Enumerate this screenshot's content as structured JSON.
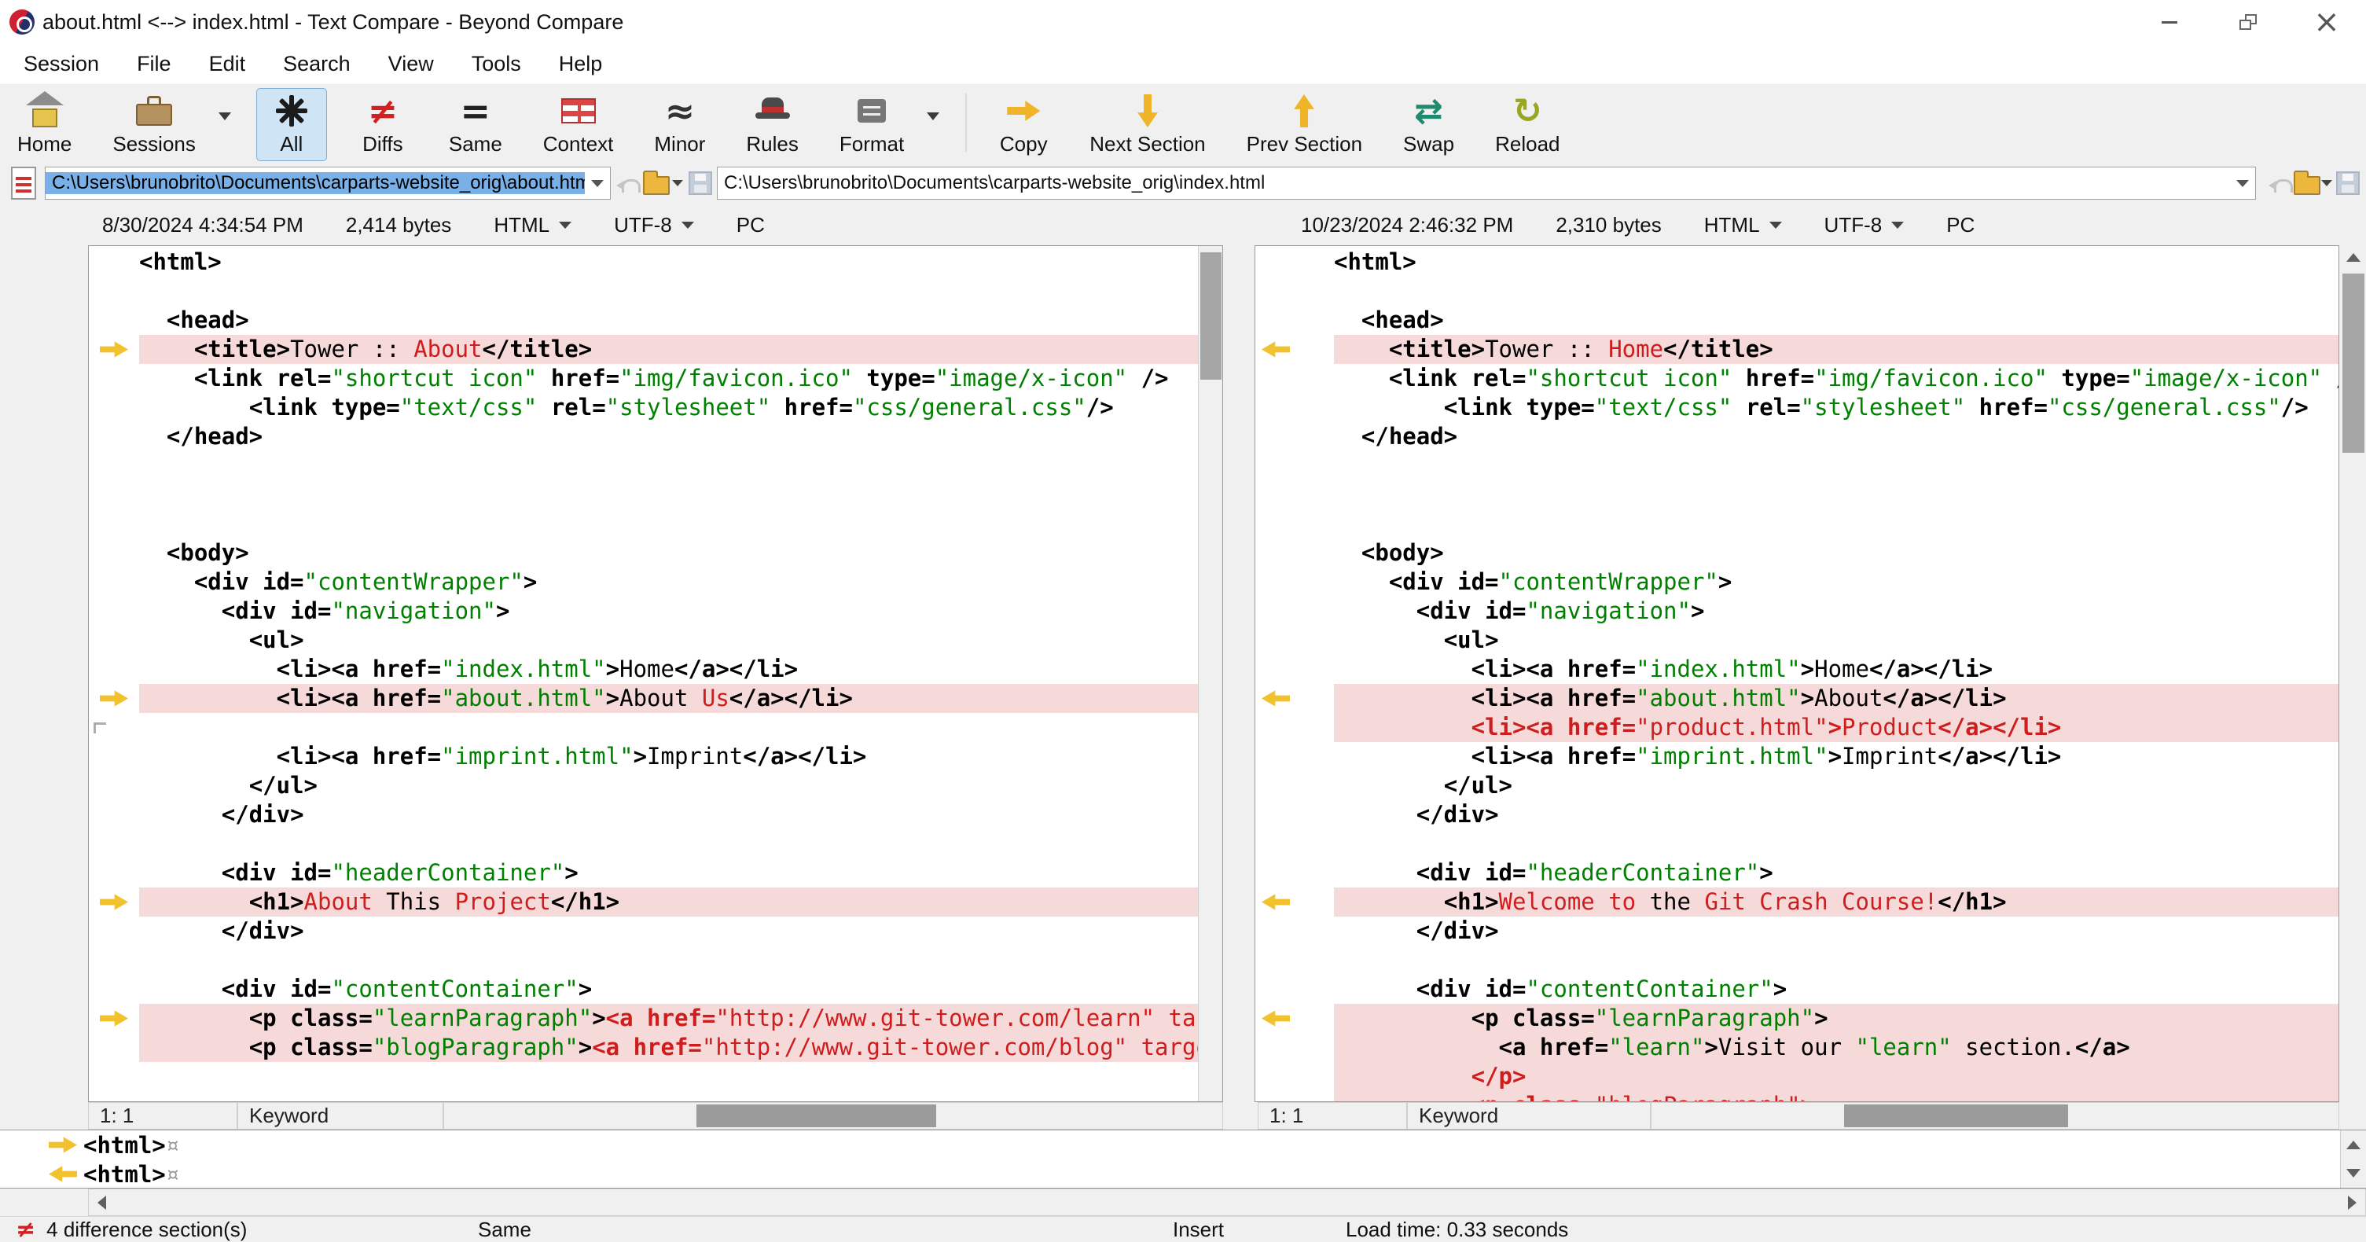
{
  "titlebar": {
    "title": "about.html <--> index.html - Text Compare - Beyond Compare"
  },
  "icons": {
    "close": "×"
  },
  "menubar": {
    "items": [
      "Session",
      "File",
      "Edit",
      "Search",
      "View",
      "Tools",
      "Help"
    ]
  },
  "toolbar": {
    "glyphs": {
      "not-equal-icon": "≠",
      "equal-icon": "=",
      "approx-icon": "≈",
      "swap-icon": "⇄",
      "reload-icon": "↻"
    },
    "buttons": [
      {
        "id": "home",
        "label": "Home",
        "icon": "home-icon",
        "dropdown": false,
        "active": false
      },
      {
        "id": "sessions",
        "label": "Sessions",
        "icon": "sessions-icon",
        "dropdown": true,
        "active": false
      },
      {
        "id": "all",
        "label": "All",
        "icon": "all-asterisk-icon",
        "dropdown": false,
        "active": true
      },
      {
        "id": "diffs",
        "label": "Diffs",
        "icon": "not-equal-icon",
        "dropdown": false,
        "active": false
      },
      {
        "id": "same",
        "label": "Same",
        "icon": "equal-icon",
        "dropdown": false,
        "active": false
      },
      {
        "id": "context",
        "label": "Context",
        "icon": "context-grid-icon",
        "dropdown": false,
        "active": false
      },
      {
        "id": "minor",
        "label": "Minor",
        "icon": "approx-icon",
        "dropdown": false,
        "active": false
      },
      {
        "id": "rules",
        "label": "Rules",
        "icon": "rules-hat-icon",
        "dropdown": false,
        "active": false
      },
      {
        "id": "format",
        "label": "Format",
        "icon": "format-icon",
        "dropdown": true,
        "active": false
      },
      {
        "id": "copy",
        "label": "Copy",
        "icon": "copy-arrow-icon",
        "dropdown": false,
        "active": false
      },
      {
        "id": "next-section",
        "label": "Next Section",
        "icon": "down-arrow-icon",
        "dropdown": false,
        "active": false
      },
      {
        "id": "prev-section",
        "label": "Prev Section",
        "icon": "up-arrow-icon",
        "dropdown": false,
        "active": false
      },
      {
        "id": "swap",
        "label": "Swap",
        "icon": "swap-icon",
        "dropdown": false,
        "active": false
      },
      {
        "id": "reload",
        "label": "Reload",
        "icon": "reload-icon",
        "dropdown": false,
        "active": false
      }
    ]
  },
  "left": {
    "path": "C:\\Users\\brunobrito\\Documents\\carparts-website_orig\\about.html",
    "modified": "8/30/2024 4:34:54 PM",
    "size": "2,414 bytes",
    "format": "HTML",
    "encoding": "UTF-8",
    "platform": "PC",
    "cursor": "1: 1",
    "rule": "Keyword"
  },
  "right": {
    "path": "C:\\Users\\brunobrito\\Documents\\carparts-website_orig\\index.html",
    "modified": "10/23/2024 2:46:32 PM",
    "size": "2,310 bytes",
    "format": "HTML",
    "encoding": "UTF-8",
    "platform": "PC",
    "cursor": "1: 1",
    "rule": "Keyword"
  },
  "detail": {
    "rows": [
      {
        "dir": "right",
        "text": "<html>",
        "eol": "¤"
      },
      {
        "dir": "left",
        "text": "<html>",
        "eol": "¤"
      }
    ]
  },
  "statusbar": {
    "sections": "4 difference section(s)",
    "compare": "Same",
    "edit_mode": "Insert",
    "load_time": "Load time: 0.33 seconds"
  },
  "colors": {
    "diff_background": "#f6d9d9",
    "difference_text": "#cf1d1d",
    "string_text": "#008000",
    "section_marker": "#f2c12e",
    "path_selection": "#79b0e8"
  },
  "code": {
    "left_lines": [
      {
        "s": [
          [
            "<html>",
            "t"
          ]
        ]
      },
      {
        "s": []
      },
      {
        "s": [
          [
            "  ",
            "p"
          ],
          [
            "<head>",
            "t"
          ]
        ]
      },
      {
        "d": 1,
        "m": "r",
        "s": [
          [
            "    ",
            "p"
          ],
          [
            "<title>",
            "t"
          ],
          [
            "Tower :: ",
            "p"
          ],
          [
            "About",
            "r"
          ],
          [
            "</title>",
            "t"
          ]
        ]
      },
      {
        "s": [
          [
            "    ",
            "p"
          ],
          [
            "<link rel=",
            "t"
          ],
          [
            "\"shortcut icon\"",
            "s"
          ],
          [
            " href=",
            "t"
          ],
          [
            "\"img/favicon.ico\"",
            "s"
          ],
          [
            " type=",
            "t"
          ],
          [
            "\"image/x-icon\"",
            "s"
          ],
          [
            " />",
            "t"
          ]
        ]
      },
      {
        "s": [
          [
            "        ",
            "p"
          ],
          [
            "<link type=",
            "t"
          ],
          [
            "\"text/css\"",
            "s"
          ],
          [
            " rel=",
            "t"
          ],
          [
            "\"stylesheet\"",
            "s"
          ],
          [
            " href=",
            "t"
          ],
          [
            "\"css/general.css\"",
            "s"
          ],
          [
            "/>",
            "t"
          ]
        ]
      },
      {
        "s": [
          [
            "  ",
            "p"
          ],
          [
            "</head>",
            "t"
          ]
        ]
      },
      {
        "s": []
      },
      {
        "s": []
      },
      {
        "s": []
      },
      {
        "s": [
          [
            "  ",
            "p"
          ],
          [
            "<body>",
            "t"
          ]
        ]
      },
      {
        "s": [
          [
            "    ",
            "p"
          ],
          [
            "<div id=",
            "t"
          ],
          [
            "\"contentWrapper\"",
            "s"
          ],
          [
            ">",
            "t"
          ]
        ]
      },
      {
        "s": [
          [
            "      ",
            "p"
          ],
          [
            "<div id=",
            "t"
          ],
          [
            "\"navigation\"",
            "s"
          ],
          [
            ">",
            "t"
          ]
        ]
      },
      {
        "s": [
          [
            "        ",
            "p"
          ],
          [
            "<ul>",
            "t"
          ]
        ]
      },
      {
        "s": [
          [
            "          ",
            "p"
          ],
          [
            "<li><a href=",
            "t"
          ],
          [
            "\"index.html\"",
            "s"
          ],
          [
            ">",
            "t"
          ],
          [
            "Home",
            "p"
          ],
          [
            "</a></li>",
            "t"
          ]
        ]
      },
      {
        "d": 1,
        "m": "r",
        "s": [
          [
            "          ",
            "p"
          ],
          [
            "<li><a href=",
            "t"
          ],
          [
            "\"about.html\"",
            "s"
          ],
          [
            ">",
            "t"
          ],
          [
            "About ",
            "p"
          ],
          [
            "Us",
            "r"
          ],
          [
            "</a></li>",
            "t"
          ]
        ]
      },
      {
        "m": "gap",
        "s": []
      },
      {
        "s": [
          [
            "          ",
            "p"
          ],
          [
            "<li><a href=",
            "t"
          ],
          [
            "\"imprint.html\"",
            "s"
          ],
          [
            ">",
            "t"
          ],
          [
            "Imprint",
            "p"
          ],
          [
            "</a></li>",
            "t"
          ]
        ]
      },
      {
        "s": [
          [
            "        ",
            "p"
          ],
          [
            "</ul>",
            "t"
          ]
        ]
      },
      {
        "s": [
          [
            "      ",
            "p"
          ],
          [
            "</div>",
            "t"
          ]
        ]
      },
      {
        "s": []
      },
      {
        "s": [
          [
            "      ",
            "p"
          ],
          [
            "<div id=",
            "t"
          ],
          [
            "\"headerContainer\"",
            "s"
          ],
          [
            ">",
            "t"
          ]
        ]
      },
      {
        "d": 1,
        "m": "r",
        "s": [
          [
            "        ",
            "p"
          ],
          [
            "<h1>",
            "t"
          ],
          [
            "About ",
            "r"
          ],
          [
            "This",
            "p"
          ],
          [
            " Project",
            "r"
          ],
          [
            "</h1>",
            "t"
          ]
        ]
      },
      {
        "s": [
          [
            "      ",
            "p"
          ],
          [
            "</div>",
            "t"
          ]
        ]
      },
      {
        "s": []
      },
      {
        "s": [
          [
            "      ",
            "p"
          ],
          [
            "<div id=",
            "t"
          ],
          [
            "\"contentContainer\"",
            "s"
          ],
          [
            ">",
            "t"
          ]
        ]
      },
      {
        "d": 1,
        "m": "r",
        "s": [
          [
            "        ",
            "p"
          ],
          [
            "<p class=",
            "t"
          ],
          [
            "\"learnParagraph\"",
            "s"
          ],
          [
            ">",
            "t"
          ],
          [
            "<a href=",
            "rt"
          ],
          [
            "\"http://www.git-tower.com/learn\"",
            "r"
          ],
          [
            " targ",
            "r"
          ]
        ]
      },
      {
        "d": 1,
        "s": [
          [
            "        ",
            "p"
          ],
          [
            "<p class=",
            "t"
          ],
          [
            "\"blogParagraph\"",
            "s"
          ],
          [
            ">",
            "t"
          ],
          [
            "<a href=",
            "rt"
          ],
          [
            "\"http://www.git-tower.com/blog\"",
            "r"
          ],
          [
            " target",
            "r"
          ]
        ]
      }
    ],
    "right_lines": [
      {
        "s": [
          [
            "<html>",
            "t"
          ]
        ]
      },
      {
        "s": []
      },
      {
        "s": [
          [
            "  ",
            "p"
          ],
          [
            "<head>",
            "t"
          ]
        ]
      },
      {
        "d": 1,
        "m": "l",
        "s": [
          [
            "    ",
            "p"
          ],
          [
            "<title>",
            "t"
          ],
          [
            "Tower :: ",
            "p"
          ],
          [
            "Home",
            "r"
          ],
          [
            "</title>",
            "t"
          ]
        ]
      },
      {
        "s": [
          [
            "    ",
            "p"
          ],
          [
            "<link rel=",
            "t"
          ],
          [
            "\"shortcut icon\"",
            "s"
          ],
          [
            " href=",
            "t"
          ],
          [
            "\"img/favicon.ico\"",
            "s"
          ],
          [
            " type=",
            "t"
          ],
          [
            "\"image/x-icon\"",
            "s"
          ],
          [
            " />",
            "t"
          ]
        ]
      },
      {
        "s": [
          [
            "        ",
            "p"
          ],
          [
            "<link type=",
            "t"
          ],
          [
            "\"text/css\"",
            "s"
          ],
          [
            " rel=",
            "t"
          ],
          [
            "\"stylesheet\"",
            "s"
          ],
          [
            " href=",
            "t"
          ],
          [
            "\"css/general.css\"",
            "s"
          ],
          [
            "/>",
            "t"
          ]
        ]
      },
      {
        "s": [
          [
            "  ",
            "p"
          ],
          [
            "</head>",
            "t"
          ]
        ]
      },
      {
        "s": []
      },
      {
        "s": []
      },
      {
        "s": []
      },
      {
        "s": [
          [
            "  ",
            "p"
          ],
          [
            "<body>",
            "t"
          ]
        ]
      },
      {
        "s": [
          [
            "    ",
            "p"
          ],
          [
            "<div id=",
            "t"
          ],
          [
            "\"contentWrapper\"",
            "s"
          ],
          [
            ">",
            "t"
          ]
        ]
      },
      {
        "s": [
          [
            "      ",
            "p"
          ],
          [
            "<div id=",
            "t"
          ],
          [
            "\"navigation\"",
            "s"
          ],
          [
            ">",
            "t"
          ]
        ]
      },
      {
        "s": [
          [
            "        ",
            "p"
          ],
          [
            "<ul>",
            "t"
          ]
        ]
      },
      {
        "s": [
          [
            "          ",
            "p"
          ],
          [
            "<li><a href=",
            "t"
          ],
          [
            "\"index.html\"",
            "s"
          ],
          [
            ">",
            "t"
          ],
          [
            "Home",
            "p"
          ],
          [
            "</a></li>",
            "t"
          ]
        ]
      },
      {
        "d": 1,
        "m": "l",
        "s": [
          [
            "          ",
            "p"
          ],
          [
            "<li><a href=",
            "t"
          ],
          [
            "\"about.html\"",
            "s"
          ],
          [
            ">",
            "t"
          ],
          [
            "About",
            "p"
          ],
          [
            "</a></li>",
            "t"
          ]
        ]
      },
      {
        "d": 1,
        "s": [
          [
            "          ",
            "r"
          ],
          [
            "<li><a href=",
            "rt"
          ],
          [
            "\"product.html\"",
            "r"
          ],
          [
            ">",
            "rt"
          ],
          [
            "Product",
            "r"
          ],
          [
            "</a></li>",
            "rt"
          ]
        ]
      },
      {
        "s": [
          [
            "          ",
            "p"
          ],
          [
            "<li><a href=",
            "t"
          ],
          [
            "\"imprint.html\"",
            "s"
          ],
          [
            ">",
            "t"
          ],
          [
            "Imprint",
            "p"
          ],
          [
            "</a></li>",
            "t"
          ]
        ]
      },
      {
        "s": [
          [
            "        ",
            "p"
          ],
          [
            "</ul>",
            "t"
          ]
        ]
      },
      {
        "s": [
          [
            "      ",
            "p"
          ],
          [
            "</div>",
            "t"
          ]
        ]
      },
      {
        "s": []
      },
      {
        "s": [
          [
            "      ",
            "p"
          ],
          [
            "<div id=",
            "t"
          ],
          [
            "\"headerContainer\"",
            "s"
          ],
          [
            ">",
            "t"
          ]
        ]
      },
      {
        "d": 1,
        "m": "l",
        "s": [
          [
            "        ",
            "p"
          ],
          [
            "<h1>",
            "t"
          ],
          [
            "Welcome to ",
            "r"
          ],
          [
            "the",
            "p"
          ],
          [
            " Git Crash Course!",
            "r"
          ],
          [
            "</h1>",
            "t"
          ]
        ]
      },
      {
        "s": [
          [
            "      ",
            "p"
          ],
          [
            "</div>",
            "t"
          ]
        ]
      },
      {
        "s": []
      },
      {
        "s": [
          [
            "      ",
            "p"
          ],
          [
            "<div id=",
            "t"
          ],
          [
            "\"contentContainer\"",
            "s"
          ],
          [
            ">",
            "t"
          ]
        ]
      },
      {
        "d": 1,
        "m": "l",
        "s": [
          [
            "          ",
            "p"
          ],
          [
            "<p class=",
            "t"
          ],
          [
            "\"learnParagraph\"",
            "s"
          ],
          [
            ">",
            "t"
          ]
        ]
      },
      {
        "d": 1,
        "s": [
          [
            "            ",
            "p"
          ],
          [
            "<a href=",
            "t"
          ],
          [
            "\"learn\"",
            "s"
          ],
          [
            ">",
            "t"
          ],
          [
            "Visit our ",
            "p"
          ],
          [
            "\"learn\"",
            "s"
          ],
          [
            " section.",
            "p"
          ],
          [
            "</a>",
            "t"
          ]
        ]
      },
      {
        "d": 1,
        "s": [
          [
            "          ",
            "r"
          ],
          [
            "</p>",
            "rt"
          ]
        ]
      },
      {
        "d": 1,
        "s": [
          [
            "          ",
            "r"
          ],
          [
            "<p class=",
            "rt"
          ],
          [
            "\"blogParagraph\"",
            "r"
          ],
          [
            ">",
            "rt"
          ]
        ]
      }
    ]
  }
}
